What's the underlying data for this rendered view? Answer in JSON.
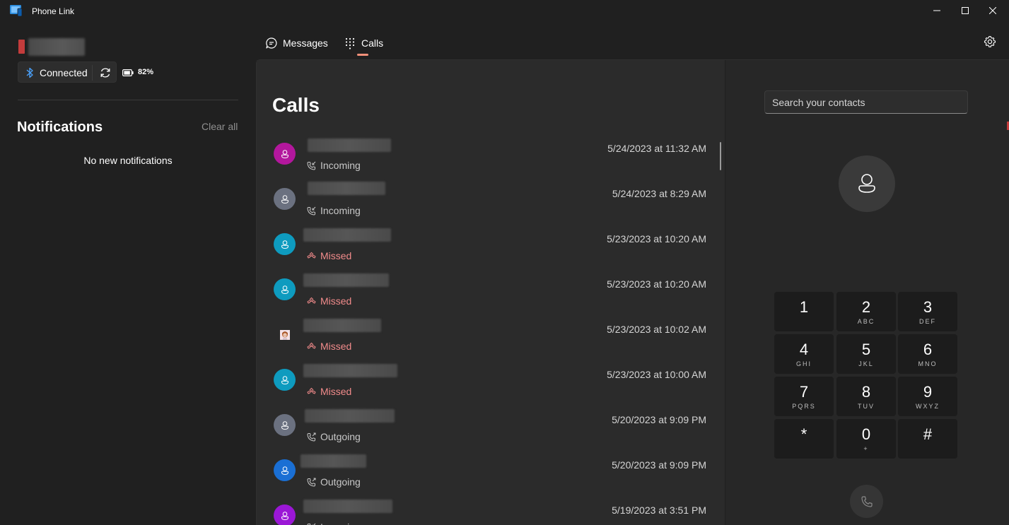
{
  "window": {
    "title": "Phone Link"
  },
  "device": {
    "status": "Connected",
    "battery": "82%"
  },
  "notifications": {
    "title": "Notifications",
    "clear_label": "Clear all",
    "empty_text": "No new notifications"
  },
  "tabs": [
    {
      "label": "Messages"
    },
    {
      "label": "Calls"
    }
  ],
  "calls": {
    "heading": "Calls",
    "items": [
      {
        "status": "Incoming",
        "type": "normal",
        "time": "5/24/2023 at 11:32 AM",
        "avatar_color": "#b3179d"
      },
      {
        "status": "Incoming",
        "type": "normal",
        "time": "5/24/2023 at 8:29 AM",
        "avatar_color": "#6b7180"
      },
      {
        "status": "Missed",
        "type": "missed",
        "time": "5/23/2023 at 10:20 AM",
        "avatar_color": "#0e9bbf"
      },
      {
        "status": "Missed",
        "type": "missed",
        "time": "5/23/2023 at 10:20 AM",
        "avatar_color": "#0e9bbf"
      },
      {
        "status": "Missed",
        "type": "missed",
        "time": "5/23/2023 at 10:02 AM",
        "avatar_color": "photo"
      },
      {
        "status": "Missed",
        "type": "missed",
        "time": "5/23/2023 at 10:00 AM",
        "avatar_color": "#0e9bbf"
      },
      {
        "status": "Outgoing",
        "type": "normal",
        "time": "5/20/2023 at 9:09 PM",
        "avatar_color": "#6b7180"
      },
      {
        "status": "Outgoing",
        "type": "normal",
        "time": "5/20/2023 at 9:09 PM",
        "avatar_color": "#1a6fd4"
      },
      {
        "status": "Incoming",
        "type": "normal",
        "time": "5/19/2023 at 3:51 PM",
        "avatar_color": "#9b17d6"
      }
    ]
  },
  "dialer": {
    "search_placeholder": "Search your contacts",
    "keys": [
      {
        "num": "1",
        "letters": ""
      },
      {
        "num": "2",
        "letters": "ABC"
      },
      {
        "num": "3",
        "letters": "DEF"
      },
      {
        "num": "4",
        "letters": "GHI"
      },
      {
        "num": "5",
        "letters": "JKL"
      },
      {
        "num": "6",
        "letters": "MNO"
      },
      {
        "num": "7",
        "letters": "PQRS"
      },
      {
        "num": "8",
        "letters": "TUV"
      },
      {
        "num": "9",
        "letters": "WXYZ"
      },
      {
        "num": "*",
        "letters": ""
      },
      {
        "num": "0",
        "letters": "+"
      },
      {
        "num": "#",
        "letters": ""
      }
    ]
  },
  "colors": {
    "accent": "#f1907a",
    "missed": "#f28b8b",
    "device_color": "#c43c3c"
  }
}
